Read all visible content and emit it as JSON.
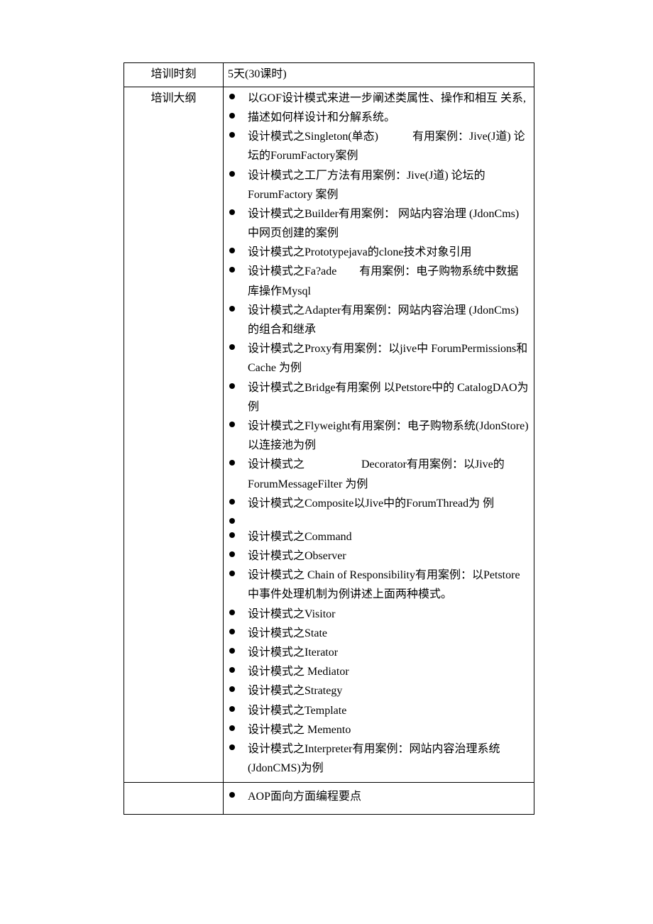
{
  "row1": {
    "label": "培训时刻",
    "value": "5天(30课时)"
  },
  "row2": {
    "label": "培训大纲",
    "items": [
      "以GOF设计模式来进一步阐述类属性、操作和相互 关系,",
      "描述如何样设计和分解系统。",
      "设计模式之Singleton(单态)   有用案例：Jive(J道) 论坛的ForumFactory案例",
      "设计模式之工厂方法有用案例：Jive(J道) 论坛的ForumFactory 案例",
      "设计模式之Builder有用案例：  网站内容治理 (JdonCms)中网页创建的案例",
      "设计模式之Prototypejava的clone技术对象引用",
      "设计模式之Fa?ade  有用案例：电子购物系统中数据库操作Mysql",
      "设计模式之Adapter有用案例：网站内容治理 (JdonCms)的组合和继承",
      "设计模式之Proxy有用案例：以jive中  ForumPermissions和 Cache 为例",
      "设计模式之Bridge有用案例 以Petstore中的 CatalogDAO为例",
      "设计模式之Flyweight有用案例：电子购物系统(JdonStore)以连接池为例",
      "设计模式之     Decorator有用案例：以Jive的ForumMessageFilter 为例",
      "设计模式之Composite以Jive中的ForumThread为 例",
      "",
      "设计模式之Command",
      "设计模式之Observer",
      "设计模式之 Chain of Responsibility有用案例：以Petstore中事件处理机制为例讲述上面两种模式。",
      "设计模式之Visitor",
      "设计模式之State",
      "设计模式之Iterator",
      "设计模式之 Mediator",
      "设计模式之Strategy",
      "设计模式之Template",
      "设计模式之 Memento",
      "设计模式之Interpreter有用案例：网站内容治理系统(JdonCMS)为例"
    ]
  },
  "row3": {
    "items": [
      "AOP面向方面编程要点"
    ]
  }
}
